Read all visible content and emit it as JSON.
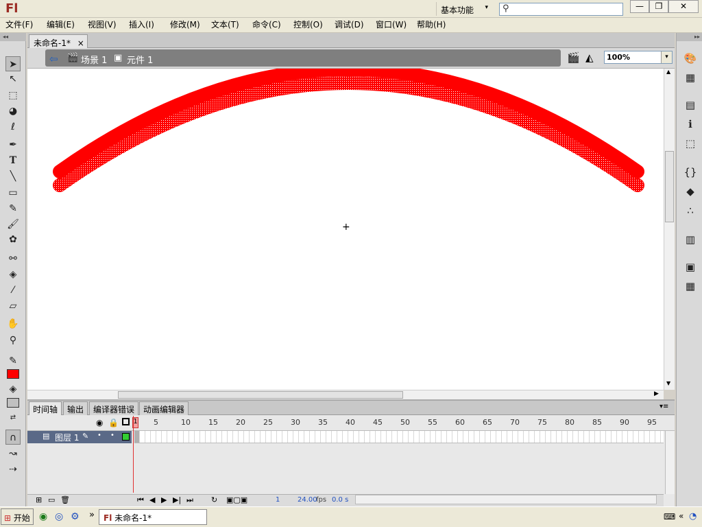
{
  "app": {
    "logo": "Fl",
    "workspace": "基本功能",
    "search_icon": "search-icon"
  },
  "window_controls": {
    "minimize": "—",
    "restore": "❐",
    "close": "✕"
  },
  "menu": [
    "文件(F)",
    "编辑(E)",
    "视图(V)",
    "插入(I)",
    "修改(M)",
    "文本(T)",
    "命令(C)",
    "控制(O)",
    "调试(D)",
    "窗口(W)",
    "帮助(H)"
  ],
  "document": {
    "tab_title": "未命名-1*",
    "tab_close": "×"
  },
  "breadcrumb": {
    "scene": "场景 1",
    "symbol": "元件 1"
  },
  "zoom": "100%",
  "stage": {
    "stroke_color": "#ff0000",
    "registration_mark": "+"
  },
  "tools": [
    "selection-tool",
    "subselection-tool",
    "free-transform-tool",
    "3d-rotation-tool",
    "lasso-tool",
    "pen-tool",
    "text-tool",
    "line-tool",
    "rectangle-tool",
    "pencil-tool",
    "brush-tool",
    "deco-tool",
    "bone-tool",
    "paint-bucket-tool",
    "eyedropper-tool",
    "eraser-tool",
    "hand-tool",
    "zoom-tool"
  ],
  "colors": {
    "stroke": "#ff0000",
    "fill": "#c0c0c0"
  },
  "timeline": {
    "tabs": [
      "时间轴",
      "输出",
      "编译器错误",
      "动画编辑器"
    ],
    "ruler": [
      "1",
      "5",
      "10",
      "15",
      "20",
      "25",
      "30",
      "35",
      "40",
      "45",
      "50",
      "55",
      "60",
      "65",
      "70",
      "75",
      "80",
      "85",
      "90",
      "95"
    ],
    "layer": "图层 1",
    "current_frame": "1",
    "fps": "24.00",
    "fps_label": "fps",
    "time": "0.0 s"
  },
  "taskbar": {
    "start": "开始",
    "window": "未命名-1*"
  }
}
